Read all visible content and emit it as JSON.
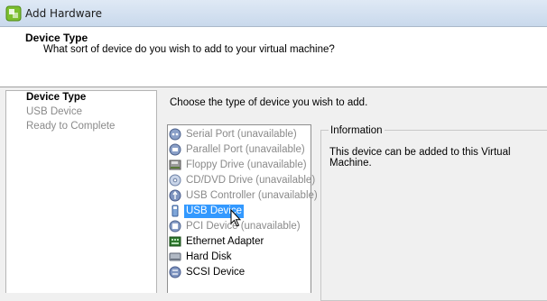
{
  "window": {
    "title": "Add Hardware"
  },
  "header": {
    "title": "Device Type",
    "subtitle": "What sort of device do you wish to add to your virtual machine?"
  },
  "steps": [
    {
      "label": "Device Type",
      "active": true
    },
    {
      "label": "USB Device",
      "active": false
    },
    {
      "label": "Ready to Complete",
      "active": false
    }
  ],
  "content": {
    "prompt": "Choose the type of device you wish to add."
  },
  "devices": [
    {
      "label": "Serial Port (unavailable)",
      "icon": "serial-port-icon",
      "state": "unavailable"
    },
    {
      "label": "Parallel Port (unavailable)",
      "icon": "parallel-port-icon",
      "state": "unavailable"
    },
    {
      "label": "Floppy Drive (unavailable)",
      "icon": "floppy-drive-icon",
      "state": "unavailable"
    },
    {
      "label": "CD/DVD Drive (unavailable)",
      "icon": "cd-dvd-drive-icon",
      "state": "unavailable"
    },
    {
      "label": "USB Controller (unavailable)",
      "icon": "usb-controller-icon",
      "state": "unavailable"
    },
    {
      "label": "USB Device",
      "icon": "usb-device-icon",
      "state": "selected"
    },
    {
      "label": "PCI Device (unavailable)",
      "icon": "pci-device-icon",
      "state": "unavailable"
    },
    {
      "label": "Ethernet Adapter",
      "icon": "ethernet-adapter-icon",
      "state": "available"
    },
    {
      "label": "Hard Disk",
      "icon": "hard-disk-icon",
      "state": "available"
    },
    {
      "label": "SCSI Device",
      "icon": "scsi-device-icon",
      "state": "available"
    }
  ],
  "information": {
    "legend": "Information",
    "text": "This device can be added to this Virtual Machine."
  },
  "colors": {
    "selection": "#3399ff",
    "disabled_text": "#8a8a8a"
  }
}
